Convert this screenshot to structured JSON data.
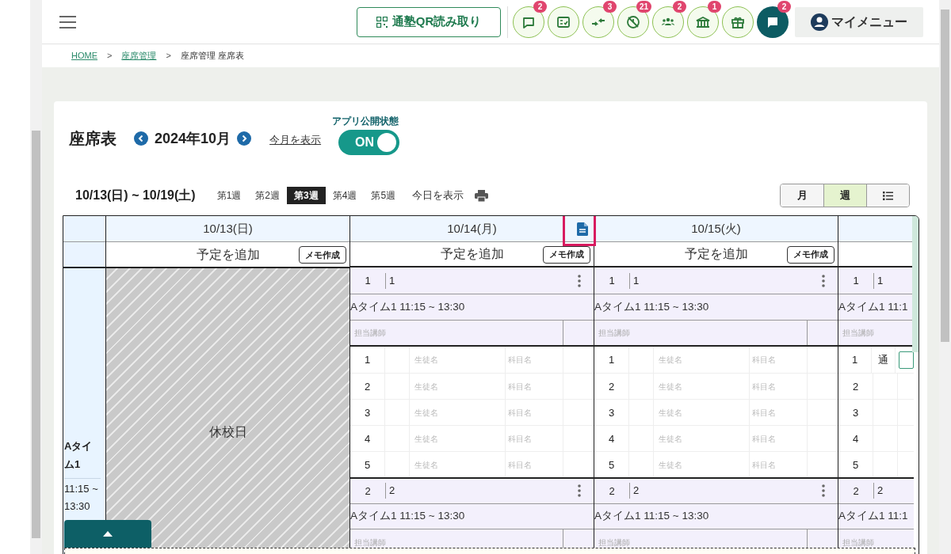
{
  "header": {
    "qr_button": "通塾QR読み取り",
    "icon_buttons": [
      {
        "kind": "chat",
        "badge": "2"
      },
      {
        "kind": "checklist"
      },
      {
        "kind": "arrows",
        "badge": "3"
      },
      {
        "kind": "no-clock",
        "badge": "21"
      },
      {
        "kind": "group",
        "badge": "2"
      },
      {
        "kind": "school",
        "badge": "1"
      },
      {
        "kind": "gift"
      },
      {
        "kind": "message",
        "badge": "2"
      }
    ],
    "my_menu": "マイメニュー"
  },
  "breadcrumb": [
    {
      "kind": "link",
      "label": "HOME"
    },
    {
      "kind": "separator",
      "label": ">"
    },
    {
      "kind": "link",
      "label": "座席管理"
    },
    {
      "kind": "separator",
      "label": ">"
    },
    {
      "kind": "current",
      "label": "座席管理 座席表"
    }
  ],
  "title": "座席表",
  "month": "2024年10月",
  "this_month_link": "今月を表示",
  "app_public": {
    "label": "アプリ公開状態",
    "on": true,
    "text": "ON"
  },
  "week_range": "10/13(日) ~ 10/19(土)",
  "weeks": [
    {
      "label": "第1週",
      "selected": false
    },
    {
      "label": "第2週",
      "selected": false
    },
    {
      "label": "第3週",
      "selected": true
    },
    {
      "label": "第4週",
      "selected": false
    },
    {
      "label": "第5週",
      "selected": false
    }
  ],
  "today_link": "今日を表示",
  "view_toggle": [
    {
      "kind": "text",
      "label": "月",
      "selected": false
    },
    {
      "kind": "text",
      "label": "週",
      "selected": true
    },
    {
      "kind": "list-icon",
      "selected": false
    }
  ],
  "table": {
    "time_slot": {
      "name": "Aタイム1",
      "time": "11:15 ~ 13:30"
    },
    "days": [
      {
        "kind": "closed",
        "date": "10/13(日)",
        "add_label": "予定を追加",
        "memo_button": "メモ作成",
        "memo_icon": false,
        "annotation_frame": false,
        "closed_label": "休校日"
      },
      {
        "kind": "open",
        "date": "10/14(月)",
        "add_label": "予定を追加",
        "memo_button": "メモ作成",
        "memo_icon": true,
        "annotation_frame": true,
        "slots": [
          {
            "number": "1",
            "name": "1",
            "time_label": "Aタイム1 11:15 ~ 13:30",
            "teacher_placeholder": "担当講師",
            "students": [
              {
                "number": "1",
                "student_placeholder": "生徒名",
                "subject_placeholder": "科目名"
              },
              {
                "number": "2",
                "student_placeholder": "生徒名",
                "subject_placeholder": "科目名"
              },
              {
                "number": "3",
                "student_placeholder": "生徒名",
                "subject_placeholder": "科目名"
              },
              {
                "number": "4",
                "student_placeholder": "生徒名",
                "subject_placeholder": "科目名"
              },
              {
                "number": "5",
                "student_placeholder": "生徒名",
                "subject_placeholder": "科目名"
              }
            ]
          },
          {
            "number": "2",
            "name": "2",
            "time_label": "Aタイム1 11:15 ~ 13:30",
            "teacher_placeholder": "担当講師"
          }
        ]
      },
      {
        "kind": "open",
        "date": "10/15(火)",
        "add_label": "予定を追加",
        "memo_button": "メモ作成",
        "memo_icon": false,
        "annotation_frame": false,
        "slots": [
          {
            "number": "1",
            "name": "1",
            "time_label": "Aタイム1 11:15 ~ 13:30",
            "teacher_placeholder": "担当講師",
            "students": [
              {
                "number": "1",
                "student_placeholder": "生徒名",
                "subject_placeholder": "科目名"
              },
              {
                "number": "2",
                "student_placeholder": "生徒名",
                "subject_placeholder": "科目名"
              },
              {
                "number": "3",
                "student_placeholder": "生徒名",
                "subject_placeholder": "科目名"
              },
              {
                "number": "4",
                "student_placeholder": "生徒名",
                "subject_placeholder": "科目名"
              },
              {
                "number": "5",
                "student_placeholder": "生徒名",
                "subject_placeholder": "科目名"
              }
            ]
          },
          {
            "number": "2",
            "name": "2",
            "time_label": "Aタイム1 11:15 ~ 13:30",
            "teacher_placeholder": "担当講師"
          }
        ]
      },
      {
        "kind": "partial",
        "slots": [
          {
            "number": "1",
            "name": "1",
            "time_label": "Aタイム1 11:1",
            "teacher_placeholder": "担当講師",
            "students": [
              {
                "number": "1",
                "mark": "通",
                "field": true
              },
              {
                "number": "2",
                "field": false
              },
              {
                "number": "3",
                "field": false
              },
              {
                "number": "4",
                "field": false
              },
              {
                "number": "5",
                "field": false
              }
            ]
          },
          {
            "number": "2",
            "name": "2",
            "time_label": "Aタイム1 11:1",
            "teacher_placeholder": "担当講師"
          }
        ]
      }
    ]
  }
}
